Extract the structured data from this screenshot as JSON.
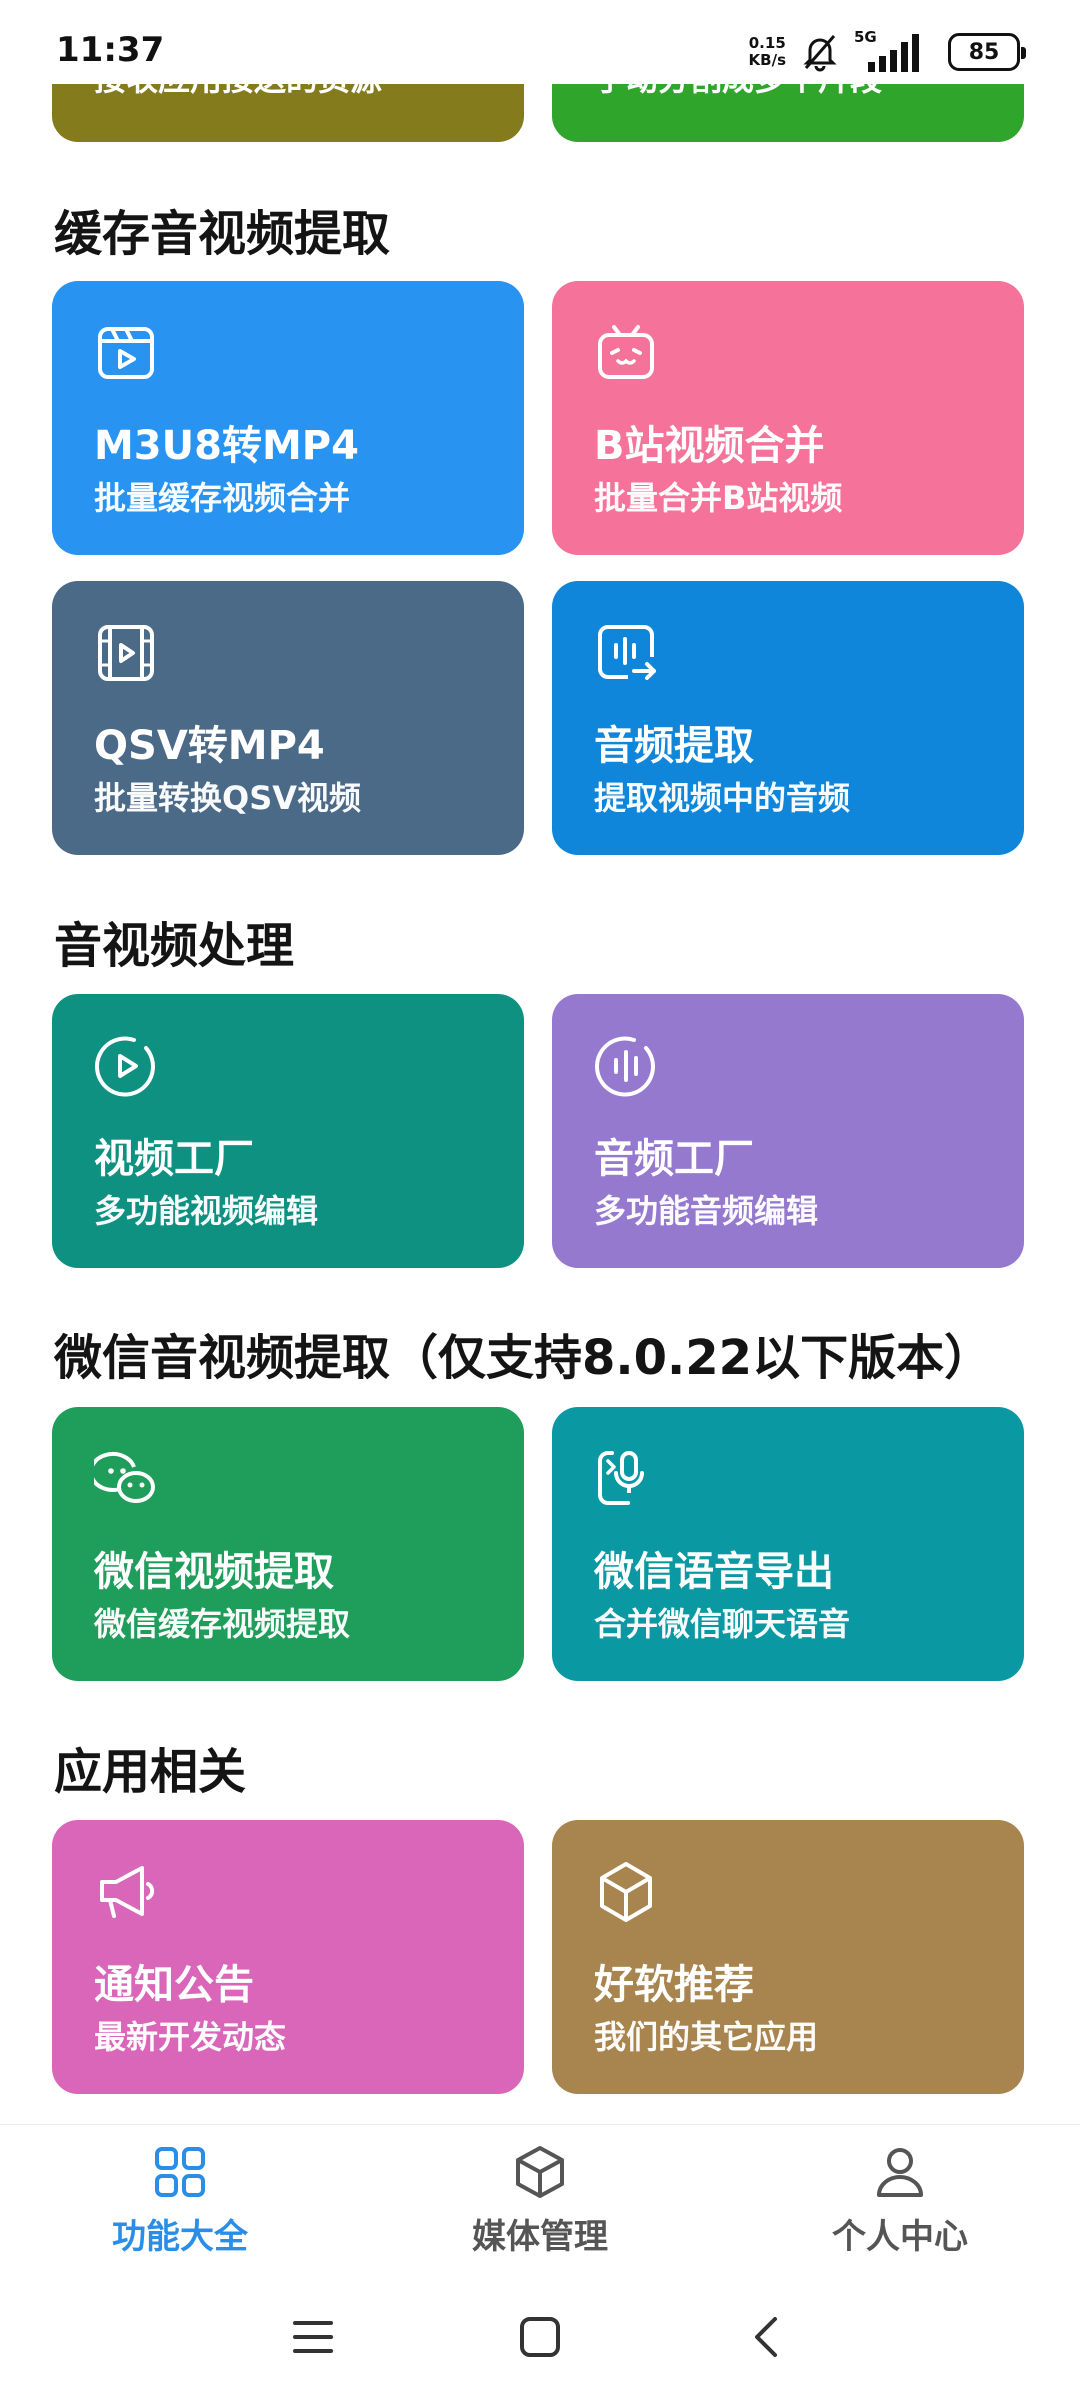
{
  "status_bar": {
    "time": "11:37",
    "net_speed_value": "0.15",
    "net_speed_unit": "KB/s",
    "signal_label": "5G",
    "battery": "85"
  },
  "top_partial": {
    "left_text": "接收应用接送的资源",
    "right_text": "手动分割成多个片段",
    "left_color": "#837B1C",
    "right_color": "#2FA62B"
  },
  "sections": {
    "cache": {
      "title": "缓存音视频提取"
    },
    "process": {
      "title": "音视频处理"
    },
    "wechat": {
      "title": "微信音视频提取（仅支持8.0.22以下版本）"
    },
    "app": {
      "title": "应用相关"
    }
  },
  "cards": {
    "m3u8": {
      "title": "M3U8转MP4",
      "subtitle": "批量缓存视频合并",
      "icon": "video-clip-icon",
      "color": "#2893F0"
    },
    "bili": {
      "title": "B站视频合并",
      "subtitle": "批量合并B站视频",
      "icon": "bilibili-tv-icon",
      "color": "#F5729A"
    },
    "qsv": {
      "title": "QSV转MP4",
      "subtitle": "批量转换QSV视频",
      "icon": "film-strip-icon",
      "color": "#4B6A88"
    },
    "audio_extract": {
      "title": "音频提取",
      "subtitle": "提取视频中的音频",
      "icon": "audio-export-icon",
      "color": "#0F86DA"
    },
    "video_factory": {
      "title": "视频工厂",
      "subtitle": "多功能视频编辑",
      "icon": "play-circle-icon",
      "color": "#0E9180"
    },
    "audio_factory": {
      "title": "音频工厂",
      "subtitle": "多功能音频编辑",
      "icon": "audio-wave-circle-icon",
      "color": "#9479CF"
    },
    "wechat_video": {
      "title": "微信视频提取",
      "subtitle": "微信缓存视频提取",
      "icon": "wechat-icon",
      "color": "#1F9D5B"
    },
    "wechat_voice": {
      "title": "微信语音导出",
      "subtitle": "合并微信聊天语音",
      "icon": "mic-export-icon",
      "color": "#0A98A3"
    },
    "notice": {
      "title": "通知公告",
      "subtitle": "最新开发动态",
      "icon": "megaphone-icon",
      "color": "#D966B8"
    },
    "recommend": {
      "title": "好软推荐",
      "subtitle": "我们的其它应用",
      "icon": "cube-icon",
      "color": "#A8854E"
    }
  },
  "bottom_nav": {
    "items": [
      {
        "label": "功能大全",
        "icon": "grid-icon"
      },
      {
        "label": "媒体管理",
        "icon": "box-icon"
      },
      {
        "label": "个人中心",
        "icon": "person-icon"
      }
    ],
    "active_color": "#2A8EE6"
  }
}
